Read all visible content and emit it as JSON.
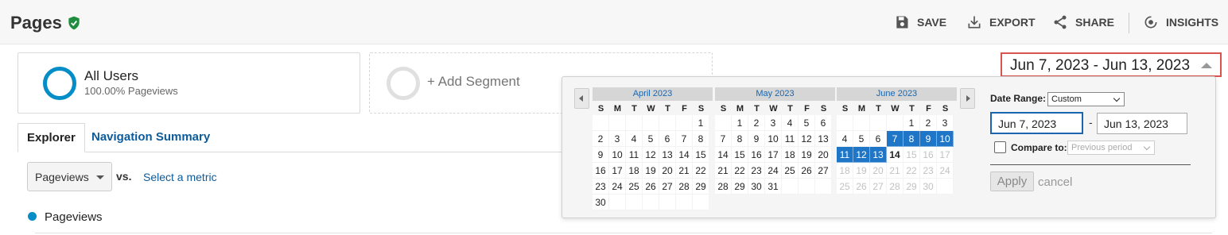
{
  "header": {
    "title": "Pages",
    "actions": {
      "save": "SAVE",
      "export": "EXPORT",
      "share": "SHARE",
      "insights": "INSIGHTS"
    }
  },
  "segments": {
    "all_users": {
      "name": "All Users",
      "sub": "100.00% Pageviews"
    },
    "add": {
      "label": "+ Add Segment"
    }
  },
  "tabs": {
    "explorer": "Explorer",
    "navigation": "Navigation Summary"
  },
  "metric": {
    "selected": "Pageviews",
    "vs": "vs.",
    "select_link": "Select a metric",
    "legend": "Pageviews"
  },
  "date_trigger": "Jun 7, 2023 - Jun 13, 2023",
  "picker": {
    "weekday_headers": [
      "S",
      "M",
      "T",
      "W",
      "T",
      "F",
      "S"
    ],
    "months": [
      {
        "title": "April 2023",
        "first_weekday": 6,
        "days": 30,
        "selected": [],
        "today": null,
        "future_from": null
      },
      {
        "title": "May 2023",
        "first_weekday": 1,
        "days": 31,
        "selected": [],
        "today": null,
        "future_from": null
      },
      {
        "title": "June 2023",
        "first_weekday": 4,
        "days": 30,
        "selected": [
          7,
          8,
          9,
          10,
          11,
          12,
          13
        ],
        "today": 14,
        "future_from": 15
      }
    ],
    "date_range_label": "Date Range:",
    "date_range_value": "Custom",
    "start": "Jun 7, 2023",
    "dash": "-",
    "end": "Jun 13, 2023",
    "compare_label": "Compare to:",
    "compare_value": "Previous period",
    "apply": "Apply",
    "cancel": "cancel"
  },
  "colors": {
    "accent": "#058dc7",
    "link": "#0d5b9b",
    "selection": "#1f76c6",
    "verified": "#1e8e3e",
    "highlight_border": "#d9534f"
  }
}
